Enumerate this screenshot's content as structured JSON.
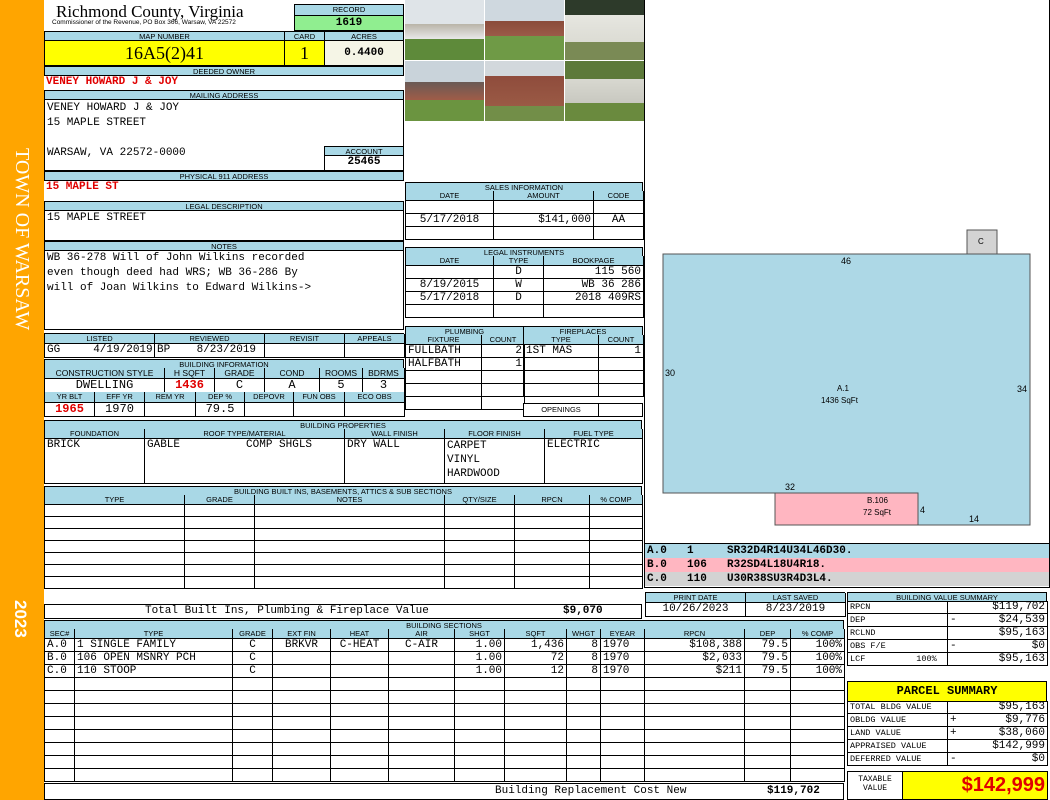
{
  "side": {
    "town": "TOWN OF WARSAW",
    "year": "2023"
  },
  "header": {
    "county": "Richmond County, Virginia",
    "subtitle": "Commissioner of the Revenue, PO Box 366, Warsaw, VA 22572",
    "record_label": "RECORD",
    "record": "1619"
  },
  "map": {
    "map_label": "MAP NUMBER",
    "map_number": "16A5(2)41",
    "card_label": "CARD",
    "card": "1",
    "acres_label": "ACRES",
    "acres": "0.4400"
  },
  "owner": {
    "label": "DEEDED OWNER",
    "name": "VENEY HOWARD J & JOY"
  },
  "mailing": {
    "label": "MAILING ADDRESS",
    "line1": "VENEY HOWARD J & JOY",
    "line2": "15 MAPLE STREET",
    "line3": "WARSAW, VA 22572-0000",
    "account_label": "ACCOUNT",
    "account": "25465"
  },
  "physical": {
    "label": "PHYSICAL 911 ADDRESS",
    "value": "15 MAPLE ST"
  },
  "legal": {
    "label": "LEGAL DESCRIPTION",
    "value": "15 MAPLE STREET"
  },
  "notes": {
    "label": "NOTES",
    "lines": [
      "WB 36-278 Will of John Wilkins recorded",
      "even though deed had WRS; WB 36-286 By",
      "will of Joan Wilkins to Edward Wilkins->"
    ]
  },
  "review": {
    "listed_label": "LISTED",
    "listed": "GG     4/19/2019",
    "reviewed_label": "REVIEWED",
    "reviewed": "BP    8/23/2019",
    "revisit_label": "REVISIT",
    "appeals_label": "APPEALS"
  },
  "building_info": {
    "label": "BUILDING INFORMATION",
    "h1": [
      "CONSTRUCTION STYLE",
      "H SQFT",
      "GRADE",
      "COND",
      "ROOMS",
      "BDRMS"
    ],
    "v1": [
      "DWELLING",
      "1436",
      "C",
      "A",
      "5",
      "3"
    ],
    "h2": [
      "YR BLT",
      "EFF YR",
      "REM YR",
      "DEP %",
      "DEPOVR",
      "FUN OBS",
      "ECO OBS"
    ],
    "v2": [
      "1965",
      "1970",
      "",
      "79.5",
      "",
      "",
      ""
    ]
  },
  "sales": {
    "label": "SALES INFORMATION",
    "headers": [
      "DATE",
      "AMOUNT",
      "CODE"
    ],
    "rows": [
      [
        "",
        "",
        ""
      ],
      [
        "5/17/2018",
        "$141,000",
        "AA"
      ],
      [
        "",
        "",
        ""
      ]
    ]
  },
  "instruments": {
    "label": "LEGAL INSTRUMENTS",
    "headers": [
      "DATE",
      "TYPE",
      "BOOKPAGE"
    ],
    "rows": [
      [
        "",
        "D",
        "115 560"
      ],
      [
        "8/19/2015",
        "W",
        "WB 36 286"
      ],
      [
        "5/17/2018",
        "D",
        "2018 409RS"
      ],
      [
        "",
        "",
        ""
      ]
    ]
  },
  "plumbing": {
    "label": "PLUMBING",
    "headers": [
      "FIXTURE",
      "COUNT"
    ],
    "rows": [
      [
        "FULLBATH",
        "2"
      ],
      [
        "HALFBATH",
        "1"
      ],
      [
        "",
        ""
      ],
      [
        "",
        ""
      ],
      [
        "",
        ""
      ]
    ]
  },
  "fireplaces": {
    "label": "FIREPLACES",
    "headers": [
      "TYPE",
      "COUNT"
    ],
    "rows": [
      [
        "1ST MAS",
        "1"
      ],
      [
        "",
        ""
      ],
      [
        "",
        ""
      ],
      [
        "",
        ""
      ]
    ],
    "openings_label": "OPENINGS"
  },
  "properties": {
    "label": "BUILDING PROPERTIES",
    "headers": [
      "FOUNDATION",
      "ROOF TYPE/MATERIAL",
      "WALL FINISH",
      "FLOOR FINISH",
      "FUEL TYPE"
    ],
    "foundation": "BRICK",
    "roof": "GABLE          COMP SHGLS",
    "wall": "DRY WALL",
    "floor": "CARPET\nVINYL\nHARDWOOD",
    "fuel": "ELECTRIC"
  },
  "builtins": {
    "label": "BUILDING BUILT INS, BASEMENTS, ATTICS & SUB SECTIONS",
    "headers": [
      "TYPE",
      "GRADE",
      "NOTES",
      "QTY/SIZE",
      "RPCN",
      "% COMP"
    ],
    "total_label": "Total Built Ins, Plumbing & Fireplace Value",
    "total": "$9,070"
  },
  "sketch": {
    "a_label": "A.1",
    "a_area": "1436 SqFt",
    "b_label": "B.106",
    "b_area": "72 SqFt",
    "c_label": "C",
    "dims": {
      "top": "46",
      "left": "30",
      "right": "34",
      "b_top": "32",
      "b_right": "4",
      "bottom": "14"
    },
    "legend": [
      {
        "sec": "A.0",
        "code": "1",
        "path": "SR32D4R14U34L46D30.",
        "color": "#add8e6"
      },
      {
        "sec": "B.0",
        "code": "106",
        "path": "R32SD4L18U4R18.",
        "color": "#ffb6c1"
      },
      {
        "sec": "C.0",
        "code": "110",
        "path": "U30R38SU3R4D3L4.",
        "color": "#d3d3d3"
      }
    ]
  },
  "dates": {
    "print_label": "PRINT DATE",
    "print": "10/26/2023",
    "saved_label": "LAST SAVED",
    "saved": "8/23/2019"
  },
  "value_summary": {
    "label": "BUILDING VALUE SUMMARY",
    "rows": [
      {
        "k": "RPCN",
        "s": "",
        "v": "$119,702"
      },
      {
        "k": "DEP",
        "s": "-",
        "v": "$24,539"
      },
      {
        "k": "RCLND",
        "s": "",
        "v": "$95,163"
      },
      {
        "k": "OBS F/E",
        "s": "-",
        "v": "$0"
      },
      {
        "k": "LCF          100%",
        "s": "",
        "v": "$95,163"
      }
    ]
  },
  "sections": {
    "label": "BUILDING SECTIONS",
    "headers": [
      "SEC#",
      "TYPE",
      "GRADE",
      "EXT FIN",
      "HEAT",
      "AIR",
      "SHGT",
      "SQFT",
      "WHGT",
      "EYEAR",
      "RPCN",
      "DEP",
      "% COMP"
    ],
    "rows": [
      [
        "A.0",
        "1 SINGLE FAMILY",
        "C",
        "BRKVR",
        "C-HEAT",
        "C-AIR",
        "1.00",
        "1,436",
        "8",
        "1970",
        "$108,388",
        "79.5",
        "100%"
      ],
      [
        "B.0",
        "106 OPEN MSNRY PCH",
        "C",
        "",
        "",
        "",
        "1.00",
        "72",
        "8",
        "1970",
        "$2,033",
        "79.5",
        "100%"
      ],
      [
        "C.0",
        "110 STOOP",
        "C",
        "",
        "",
        "",
        "1.00",
        "12",
        "8",
        "1970",
        "$211",
        "79.5",
        "100%"
      ]
    ],
    "total_label": "Building Replacement Cost New",
    "total": "$119,702"
  },
  "parcel": {
    "label": "PARCEL SUMMARY",
    "rows": [
      {
        "k": "TOTAL BLDG VALUE",
        "s": "",
        "v": "$95,163"
      },
      {
        "k": "OBLDG VALUE",
        "s": "+",
        "v": "$9,776"
      },
      {
        "k": "LAND VALUE",
        "s": "+",
        "v": "$38,060"
      },
      {
        "k": "APPRAISED VALUE",
        "s": "",
        "v": "$142,999"
      },
      {
        "k": "DEFERRED VALUE",
        "s": "-",
        "v": "$0"
      }
    ],
    "taxable_label": "TAXABLE VALUE",
    "taxable": "$142,999"
  }
}
